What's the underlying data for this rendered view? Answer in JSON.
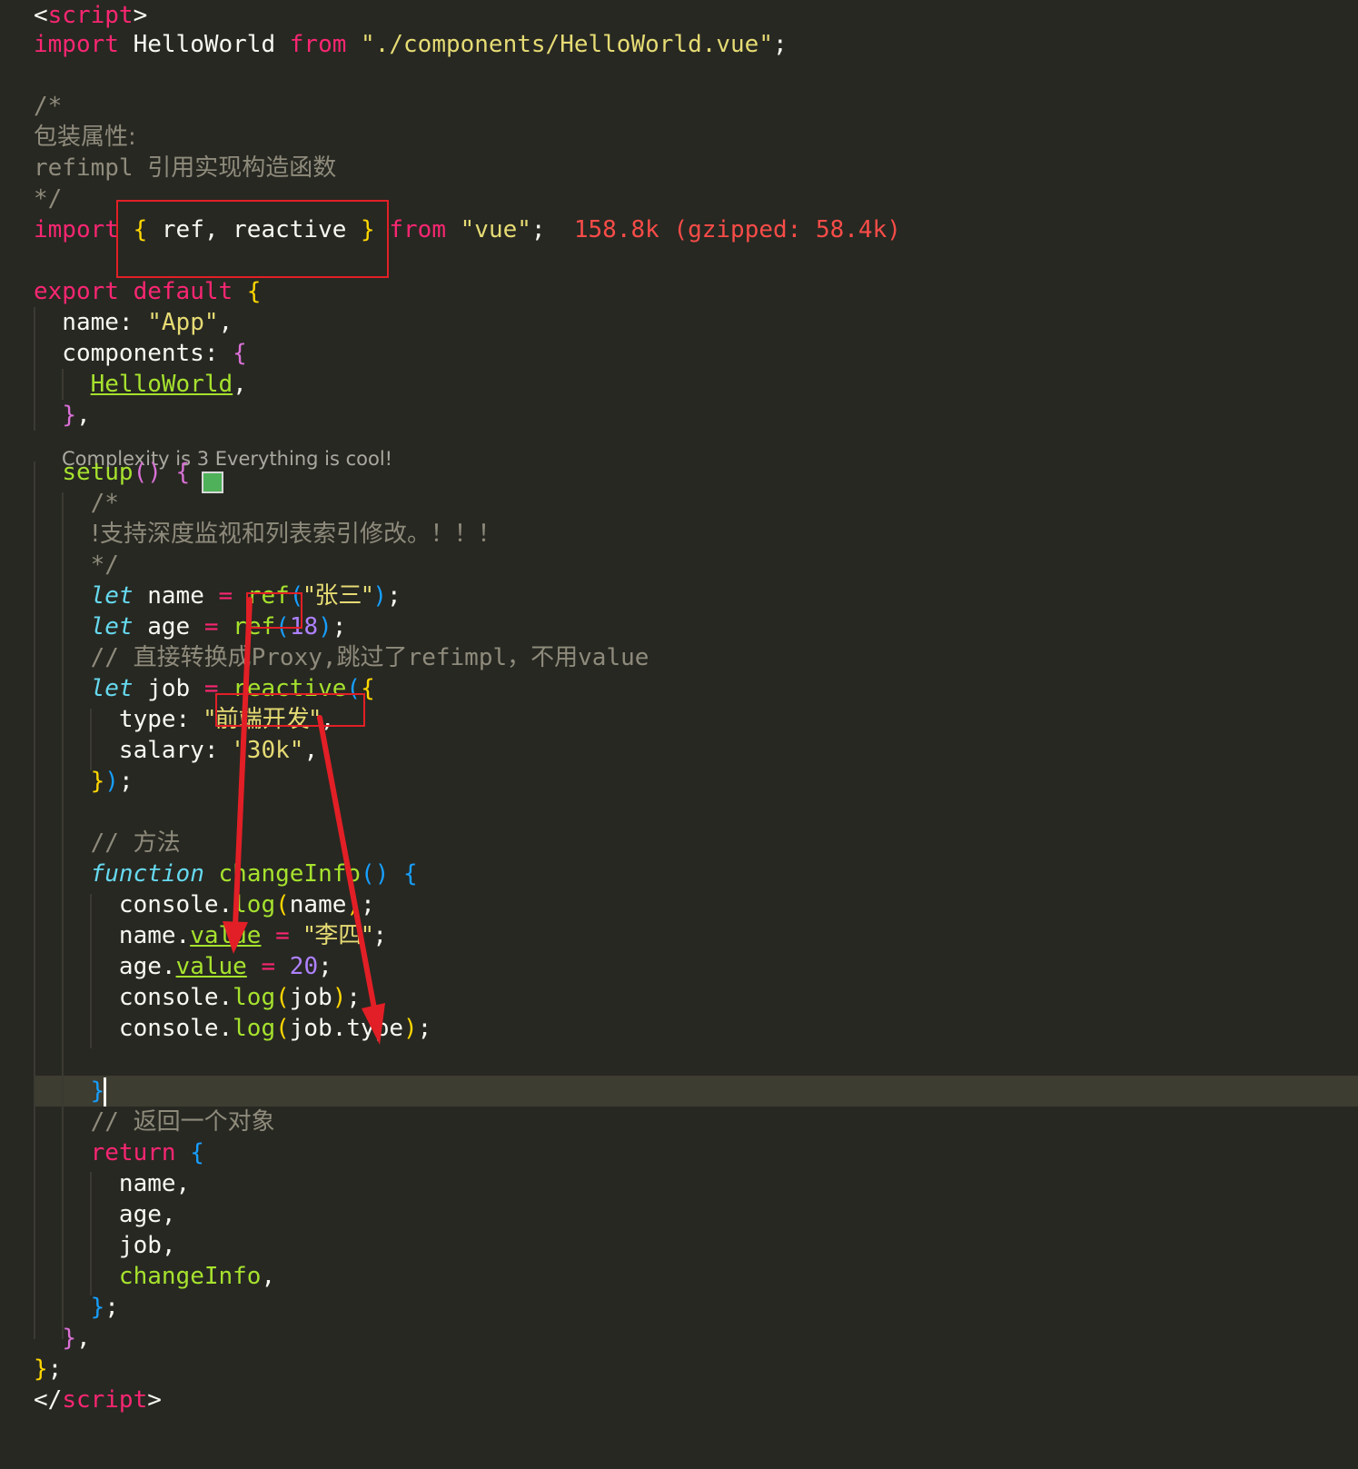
{
  "editor": {
    "lines": {
      "l1": {
        "lt": "<",
        "tag": "script",
        "gt": ">"
      },
      "l2": {
        "kw": "import",
        "name": " HelloWorld ",
        "from": "from",
        "str": "\"./components/HelloWorld.vue\"",
        "semi": ";"
      },
      "l4": {
        "c": "/*"
      },
      "l5": {
        "c": "包装属性:"
      },
      "l6": {
        "c1": "refimpl ",
        "c2": "引用实现构造函数"
      },
      "l7": {
        "c": "*/"
      },
      "l8": {
        "kw": "import",
        "ob": " { ",
        "names": "ref, reactive",
        "cb": " }",
        "from": " from",
        "str": " \"vue\"",
        "semi": ";",
        "size": "  158.8k (gzipped: 58.4k)"
      },
      "l10": {
        "kw1": "export",
        "kw2": " default",
        "ob": " {"
      },
      "l11": {
        "key": "  name: ",
        "str": "\"App\"",
        "comma": ","
      },
      "l12": {
        "key": "  components: ",
        "ob": "{"
      },
      "l13": {
        "pad": "    ",
        "comp": "HelloWorld",
        "comma": ","
      },
      "l14": {
        "pad": "  ",
        "cb": "}",
        "comma": ","
      },
      "l15": {
        "pad": "  ",
        "fn": "setup",
        "p": "()",
        "ob": " {"
      },
      "l16": {
        "c": "    /*"
      },
      "l17": {
        "pad": "    ",
        "c": "!支持深度监视和列表索引修改。！！！"
      },
      "l18": {
        "c": "    */"
      },
      "l19": {
        "pad": "    ",
        "kw": "let",
        "var": " name ",
        "eq": "=",
        "fn": " ref",
        "op": "(",
        "str": "\"张三\"",
        "cp": ")",
        "semi": ";"
      },
      "l20": {
        "pad": "    ",
        "kw": "let",
        "var": " age ",
        "eq": "=",
        "fn": " ref",
        "op": "(",
        "num": "18",
        "cp": ")",
        "semi": ";"
      },
      "l21": {
        "pad": "    ",
        "c1": "// ",
        "c2": "直接转换成",
        "c3": "Proxy,",
        "c4": "跳过了",
        "c5": "refimpl",
        "c6": "，不用",
        "c7": "value"
      },
      "l22": {
        "pad": "    ",
        "kw": "let",
        "var": " job ",
        "eq": "=",
        "fn": " reactive",
        "op": "(",
        "ob": "{"
      },
      "l23": {
        "key": "      type: ",
        "str": "\"前端开发\"",
        "comma": ","
      },
      "l24": {
        "key": "      salary: ",
        "str": "\"30k\"",
        "comma": ","
      },
      "l25": {
        "pad": "    ",
        "cb": "}",
        "cp": ")",
        "semi": ";"
      },
      "l27": {
        "pad": "    ",
        "c1": "// ",
        "c2": "方法"
      },
      "l28": {
        "pad": "    ",
        "kw": "function",
        "fn": " changeInfo",
        "p": "()",
        "ob": " {"
      },
      "l29": {
        "a": "      console.",
        "fn": "log",
        "op": "(",
        "arg": "name",
        "cp": ")",
        "semi": ";"
      },
      "l30": {
        "a": "      name.",
        "prop": "value",
        "eq": " = ",
        "str": "\"李四\"",
        "semi": ";"
      },
      "l31": {
        "a": "      age.",
        "prop": "value",
        "eq": " = ",
        "num": "20",
        "semi": ";"
      },
      "l32": {
        "a": "      console.",
        "fn": "log",
        "op": "(",
        "arg": "job",
        "cp": ")",
        "semi": ";"
      },
      "l33": {
        "a": "      console.",
        "fn": "log",
        "op": "(",
        "arg": "job.type",
        "cp": ")",
        "semi": ";"
      },
      "l34": {
        "pad": "    ",
        "cb": "}"
      },
      "l36": {
        "pad": "    ",
        "c1": "// ",
        "c2": "返回一个对象"
      },
      "l37": {
        "pad": "    ",
        "kw": "return",
        "ob": " {"
      },
      "l38": {
        "v": "      name,"
      },
      "l39": {
        "v": "      age,"
      },
      "l40": {
        "v": "      job,"
      },
      "l41": {
        "pad": "      ",
        "fn": "changeInfo",
        "comma": ","
      },
      "l42": {
        "pad": "    ",
        "cb": "}",
        "semi": ";"
      },
      "l43": {
        "pad": "  ",
        "cb": "}",
        "comma": ","
      },
      "l44": {
        "cb": "}",
        "semi": ";"
      },
      "l45": {
        "lt": "</",
        "tag": "script",
        "gt": ">"
      }
    },
    "codelens": "Complexity is 3 Everything is cool!"
  },
  "colors": {
    "background": "#272822",
    "keyword": "#f92672",
    "string": "#e6db74",
    "comment": "#8f8b7c",
    "function": "#a6e22e",
    "storage": "#66d9ef",
    "number": "#ae81ff",
    "annotation": "#e21f26"
  }
}
